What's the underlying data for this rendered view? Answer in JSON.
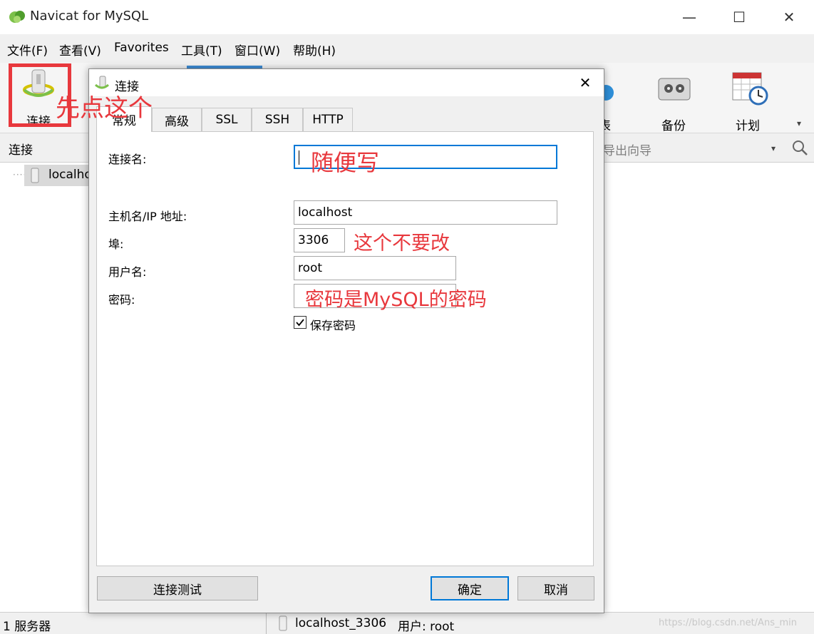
{
  "window": {
    "title": "Navicat for MySQL",
    "minimize": "—",
    "maximize": "☐",
    "close": "✕"
  },
  "menu": [
    "文件(F)",
    "查看(V)",
    "Favorites",
    "工具(T)",
    "窗口(W)",
    "帮助(H)"
  ],
  "toolbar": {
    "connect": "连接",
    "table_partial": "表",
    "backup": "备份",
    "schedule": "计划"
  },
  "connections_header": {
    "label": "连接",
    "export_wizard": "导出向导"
  },
  "tree": {
    "item": "localhost"
  },
  "status": {
    "servers": "1 服务器",
    "connection": "localhost_3306",
    "user": "用户: root"
  },
  "watermark": "https://blog.csdn.net/Ans_min",
  "dialog": {
    "title": "连接",
    "tabs": [
      "常规",
      "高级",
      "SSL",
      "SSH",
      "HTTP"
    ],
    "fields": {
      "conn_name_label": "连接名:",
      "host_label": "主机名/IP 地址:",
      "host_value": "localhost",
      "port_label": "埠:",
      "port_value": "3306",
      "user_label": "用户名:",
      "user_value": "root",
      "password_label": "密码:",
      "save_password_label": "保存密码"
    },
    "buttons": {
      "test": "连接测试",
      "ok": "确定",
      "cancel": "取消"
    }
  },
  "annotations": {
    "click_first": "先点这个",
    "write_anything": "随便写",
    "dont_change": "这个不要改",
    "password_note": "密码是MySQL的密码"
  },
  "colors": {
    "annotation": "#e8383d",
    "highlight_box": "#e8383d",
    "input_focus": "#0078d7"
  }
}
